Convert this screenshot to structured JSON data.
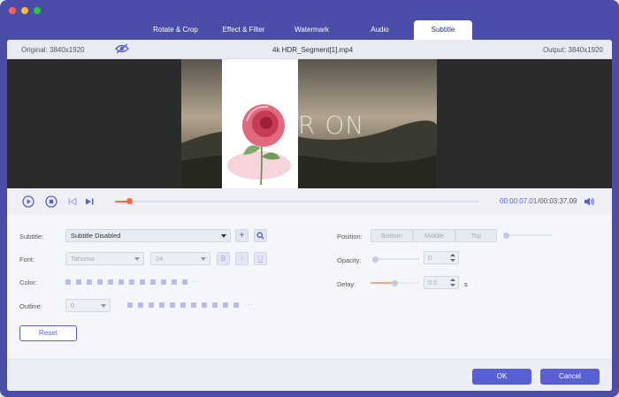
{
  "colors": {
    "accent": "#5b5fd4",
    "frame": "#4a4ea8",
    "progress": "#f06b45",
    "swatch": "#b8bbe8"
  },
  "tabs": [
    {
      "label": "Rotate & Crop"
    },
    {
      "label": "Effect & Filter"
    },
    {
      "label": "Watermark"
    },
    {
      "label": "Audio"
    },
    {
      "label": "Subtitle",
      "active": true
    }
  ],
  "infobar": {
    "original": "Original: 3840x1920",
    "filename": "4k HDR_Segment[1].mp4",
    "output": "Output: 3840x1920"
  },
  "preview": {
    "overlay_text": "R ON"
  },
  "playback": {
    "current_time": "00:00:07.01",
    "total_time": "/00:03:37.09",
    "progress": 0.04
  },
  "subtitle": {
    "label": "Subtitle:",
    "value": "Subtitle Disabled",
    "add_icon": "plus-icon",
    "search_icon": "search-icon"
  },
  "font": {
    "label": "Font:",
    "family": "Tahoma",
    "size": "24",
    "bold": "B",
    "italic": "I",
    "underline": "U"
  },
  "color": {
    "label": "Color:"
  },
  "outline": {
    "label": "Outline:",
    "value": "0"
  },
  "position": {
    "label": "Position:",
    "options": [
      "Bottom",
      "Middle",
      "Top"
    ]
  },
  "opacity": {
    "label": "Opacity:",
    "value": "0"
  },
  "delay": {
    "label": "Delay:",
    "value": "0.0",
    "unit": "s"
  },
  "buttons": {
    "reset": "Reset",
    "ok": "OK",
    "cancel": "Cancel"
  },
  "more_dots": "···"
}
